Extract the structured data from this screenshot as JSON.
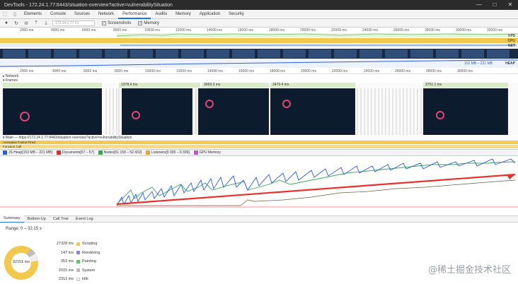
{
  "window": {
    "title": "DevTools - 172.24.1.77:8443/situation-overview?active=vulnerabilitySituation",
    "buttons": [
      "—",
      "□",
      "✕"
    ]
  },
  "tabs": [
    "Elements",
    "Console",
    "Sources",
    "Network",
    "Performance",
    "Audits",
    "Memory",
    "Application",
    "Security"
  ],
  "active_tab": "Performance",
  "toolbar": {
    "url": "172.24.1.77 #1",
    "screenshots_label": "Screenshots",
    "memory_label": "Memory"
  },
  "ticks_top": [
    "2000 ms",
    "4000 ms",
    "6000 ms",
    "8000 ms",
    "10000 ms",
    "12000 ms",
    "14000 ms",
    "16000 ms",
    "18000 ms",
    "20000 ms",
    "22000 ms",
    "24000 ms",
    "26000 ms",
    "28000 ms",
    "30000 ms",
    "32000 ms"
  ],
  "lanes": {
    "fps": "FPS",
    "cpu": "CPU",
    "net": "NET",
    "heap": "HEAP",
    "heap_range": "152 MB – 221 MB"
  },
  "ticks_mid": [
    "2000 ms",
    "4000 ms",
    "6000 ms",
    "8000 ms",
    "10000 ms",
    "12000 ms",
    "14000 ms",
    "16000 ms",
    "18000 ms",
    "20000 ms",
    "22000 ms",
    "24000 ms",
    "26000 ms",
    "28000 ms",
    "30000 ms"
  ],
  "tree": {
    "network": "Network",
    "frames": "Frames"
  },
  "frame_labels": [
    "1978.4 ms",
    "3669.3 ms",
    "3479.4 ms",
    "3751.1 ms"
  ],
  "main_label": "Main — https://172.24.1.77:8443/situation-overview?active=vulnerabilitySituation",
  "main_events": [
    "Animation Frame Fired",
    "Function Call"
  ],
  "legend": [
    {
      "label": "JS Heap[153 MB – 221 MB]",
      "color": "#2b5fd9"
    },
    {
      "label": "Documents[57 – 57]",
      "color": "#d93025"
    },
    {
      "label": "Nodes[51 158 – 52 432]",
      "color": "#3aa757"
    },
    {
      "label": "Listeners[9 005 – 9 399]",
      "color": "#e6a23c"
    },
    {
      "label": "GPU Memory",
      "color": "#b85cc9"
    }
  ],
  "bottom_tabs": [
    "Summary",
    "Bottom-Up",
    "Call Tree",
    "Event Log"
  ],
  "active_bottom": "Summary",
  "summary": {
    "range": "Range: 0 – 32.15 s",
    "total": "32151 ms",
    "rows": [
      {
        "ms": "27328 ms",
        "label": "Scripting",
        "color": "#f2c94c"
      },
      {
        "ms": "147 ms",
        "label": "Rendering",
        "color": "#9b7fd9"
      },
      {
        "ms": "352 ms",
        "label": "Painting",
        "color": "#6cbf6a"
      },
      {
        "ms": "2015 ms",
        "label": "System",
        "color": "#bdbdbd"
      },
      {
        "ms": "2312 ms",
        "label": "Idle",
        "color": "#eeeeee"
      }
    ]
  },
  "watermark": "@稀土掘金技术社区"
}
